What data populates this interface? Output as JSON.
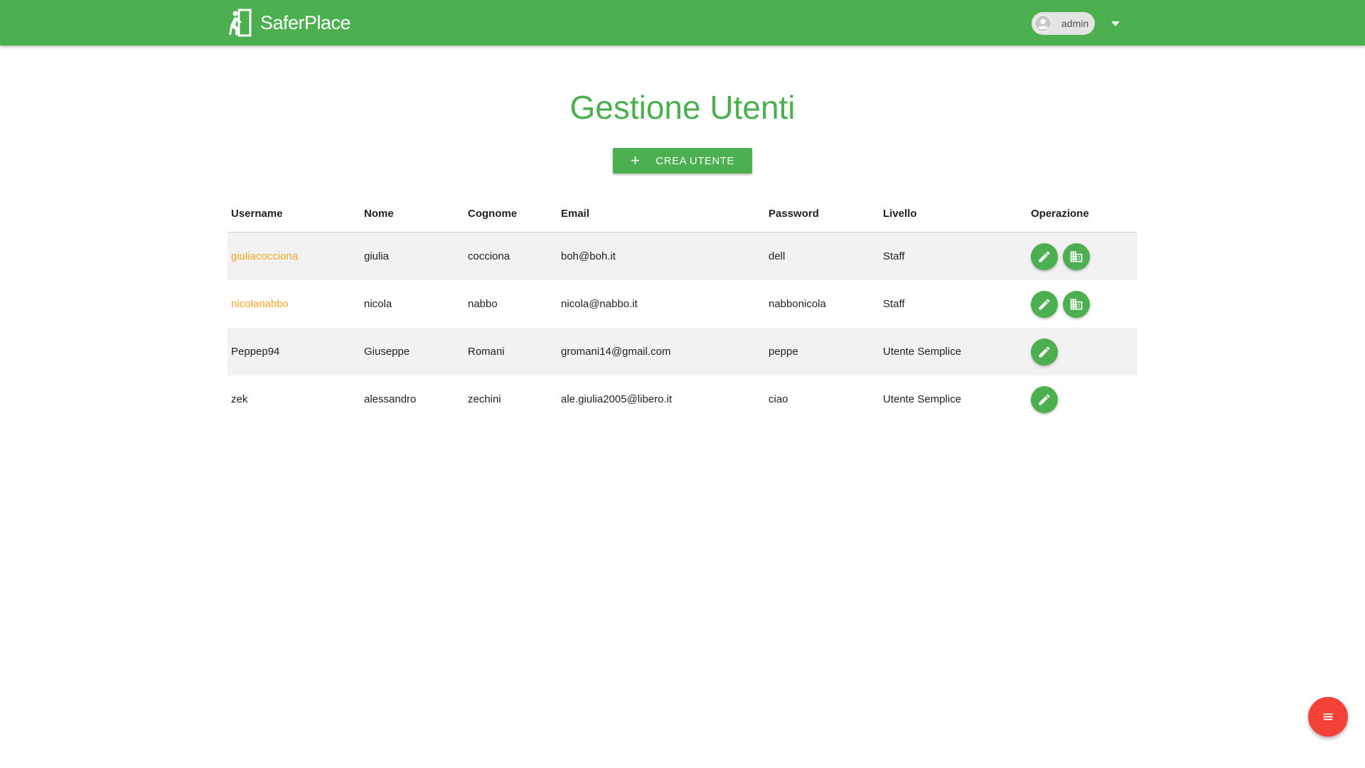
{
  "app": {
    "brand_name": "SaferPlace"
  },
  "header": {
    "user_name": "admin",
    "user_icon": "account-circle-icon",
    "dropdown_icon": "caret-down-icon"
  },
  "page": {
    "title": "Gestione Utenti",
    "create_button_label": "CREA UTENTE"
  },
  "table": {
    "columns": [
      "Username",
      "Nome",
      "Cognome",
      "Email",
      "Password",
      "Livello",
      "Operazione"
    ],
    "rows": [
      {
        "username": "giuliacocciona",
        "nome": "giulia",
        "cognome": "cocciona",
        "email": "boh@boh.it",
        "password": "dell",
        "livello": "Staff"
      },
      {
        "username": "nicolanabbo",
        "nome": "nicola",
        "cognome": "nabbo",
        "email": "nicola@nabbo.it",
        "password": "nabbonicola",
        "livello": "Staff"
      },
      {
        "username": "Peppep94",
        "nome": "Giuseppe",
        "cognome": "Romani",
        "email": "gromani14@gmail.com",
        "password": "peppe",
        "livello": "Utente Semplice"
      },
      {
        "username": "zek",
        "nome": "alessandro",
        "cognome": "zechini",
        "email": "ale.giulia2005@libero.it",
        "password": "ciao",
        "livello": "Utente Semplice"
      }
    ]
  },
  "colors": {
    "primary": "#4caf50",
    "link": "#f5a623",
    "fab": "#f44336",
    "row_stripe": "#f2f2f2"
  },
  "fab": {
    "icon": "menu-icon"
  }
}
